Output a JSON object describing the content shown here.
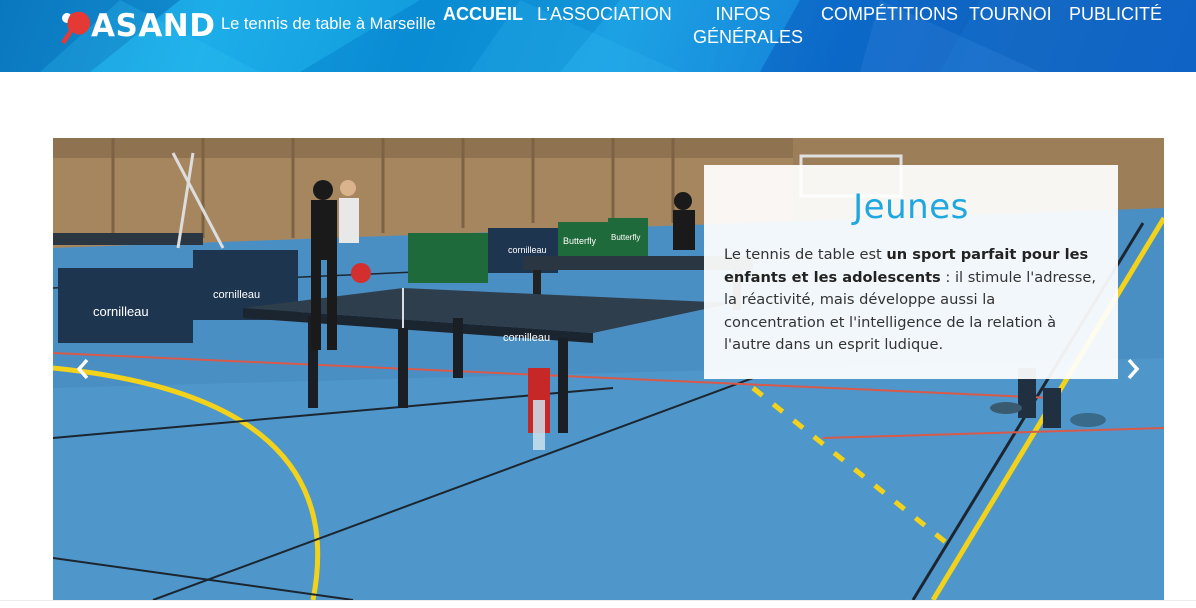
{
  "site": {
    "logo_text": "ASAND",
    "tagline": "Le tennis de table à Marseille"
  },
  "nav": {
    "items": [
      {
        "label": "ACCUEIL",
        "active": true
      },
      {
        "label": "L’ASSOCIATION",
        "active": false
      },
      {
        "label": "INFOS GÉNÉRALES",
        "active": false
      },
      {
        "label": "COMPÉTITIONS",
        "active": false
      },
      {
        "label": "TOURNOI",
        "active": false
      },
      {
        "label": "PUBLICITÉ",
        "active": false
      }
    ]
  },
  "slider": {
    "caption_title": "Jeunes",
    "caption_text_before": "Le tennis de table est ",
    "caption_text_bold": "un sport parfait pour les enfants et les adolescents",
    "caption_text_after": " : il stimule l'adresse, la réactivité, mais développe aussi la concentration et l'intelligence de la relation à l'autre dans un esprit ludique.",
    "prev_icon": "chevron-left-icon",
    "next_icon": "chevron-right-icon"
  },
  "photo": {
    "banner_texts": [
      "cornilleau",
      "cornilleau",
      "cornilleau",
      "Butterfly",
      "Butterfly"
    ],
    "table_brand": "cornilleau"
  },
  "colors": {
    "header_blue": "#1aa9e6",
    "caption_title": "#1fa8e0",
    "floor_blue": "#4a8fc4",
    "court_line_yellow": "#f2d21a"
  }
}
